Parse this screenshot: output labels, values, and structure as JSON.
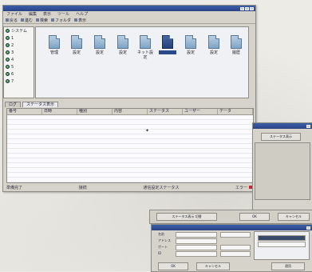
{
  "main_window": {
    "menu": [
      "ファイル",
      "編集",
      "表示",
      "ツール",
      "ヘルプ"
    ],
    "toolbar": [
      "戻る",
      "進む",
      "検索",
      "フォルダ",
      "表示"
    ],
    "tree": [
      "システム",
      "1",
      "2",
      "3",
      "4",
      "5",
      "6",
      "7"
    ],
    "files": [
      {
        "label": "管理",
        "selected": false
      },
      {
        "label": "設定",
        "selected": false
      },
      {
        "label": "設定",
        "selected": false
      },
      {
        "label": "設定",
        "selected": false
      },
      {
        "label": "ネット設定",
        "selected": false
      },
      {
        "label": "",
        "selected": true
      },
      {
        "label": "設定",
        "selected": false
      },
      {
        "label": "設定",
        "selected": false
      },
      {
        "label": "履歴",
        "selected": false
      }
    ],
    "tabs": [
      "ログ",
      "ステータス表示"
    ],
    "columns": [
      "番号",
      "日時",
      "種別",
      "内容",
      "ステータス",
      "ユーザー",
      "データ"
    ],
    "status_left": "準備完了",
    "status_mid": "接続",
    "status_center": "通信設定ステータス",
    "status_right": "エラー"
  },
  "right_window": {
    "title": "ステータス表示",
    "btn_left": "ステータス表示 切替",
    "btn_mid": "OK",
    "btn_right": "キャンセル"
  },
  "bottom_window": {
    "rows": [
      "名前",
      "アドレス",
      "ポート",
      "ID"
    ],
    "btn_a": "OK",
    "btn_b": "キャンセル",
    "btn_c": "適用"
  }
}
